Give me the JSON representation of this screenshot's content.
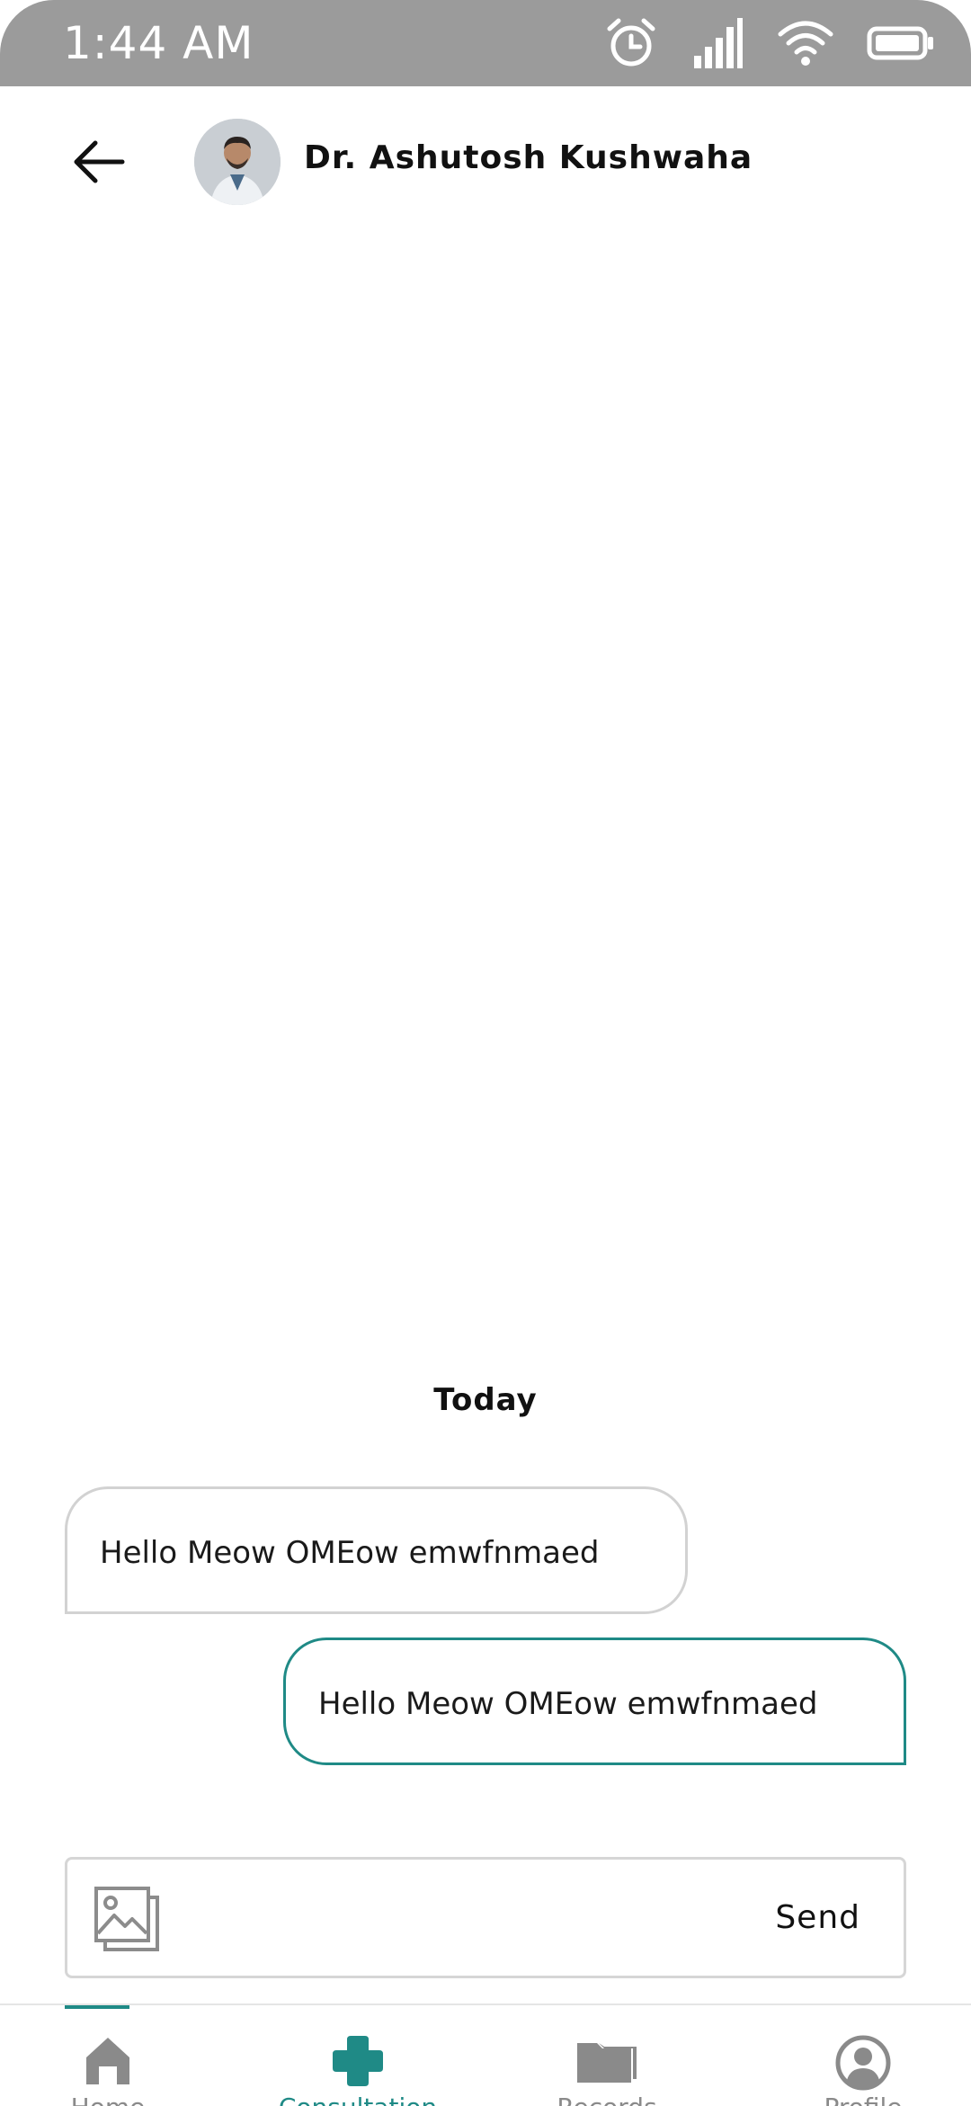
{
  "status_bar": {
    "time": "1:44 AM",
    "icons": [
      "alarm-icon",
      "signal-icon",
      "wifi-icon",
      "battery-icon"
    ]
  },
  "header": {
    "back_icon": "arrow-left-icon",
    "doctor_name": "Dr. Ashutosh Kushwaha"
  },
  "chat": {
    "date_label": "Today",
    "messages": [
      {
        "direction": "received",
        "text": "Hello Meow OMEow emwfnmaed"
      },
      {
        "direction": "sent",
        "text": "Hello Meow OMEow emwfnmaed"
      }
    ]
  },
  "composer": {
    "image_icon": "image-icon",
    "send_label": "Send"
  },
  "bottom_nav": {
    "active": "consultation",
    "items": [
      {
        "id": "home",
        "label": "Home",
        "icon": "home-icon"
      },
      {
        "id": "consultation",
        "label": "Consultation",
        "icon": "medical-cross-icon"
      },
      {
        "id": "records",
        "label": "Records",
        "icon": "folder-icon"
      },
      {
        "id": "profile",
        "label": "Profile",
        "icon": "account-circle-icon"
      }
    ]
  },
  "colors": {
    "accent": "#1f8a86",
    "status_bar": "#9b9b9b",
    "inactive_icon": "#8a8a8a",
    "received_border": "#d2d2d2"
  }
}
